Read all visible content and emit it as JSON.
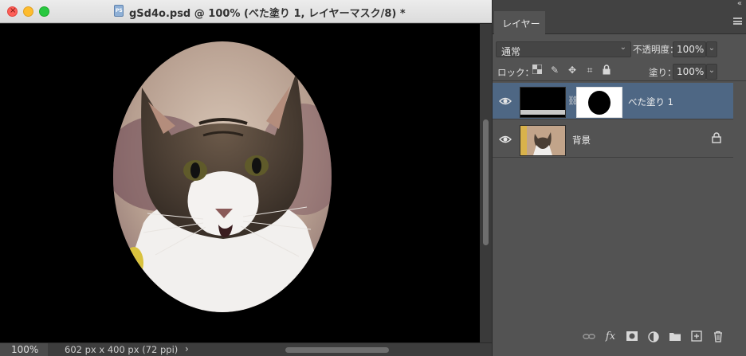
{
  "document": {
    "title": "gSd4o.psd @ 100% (べた塗り 1, レイヤーマスク/8) *",
    "file_icon_label": "PS",
    "zoom": "100%",
    "doc_info": "602 px x 400 px (72 ppi)",
    "status_arrow": "›"
  },
  "panel": {
    "tab_label": "レイヤー",
    "blend_mode": "通常",
    "opacity_label": "不透明度：",
    "opacity_value": "100%",
    "lock_label": "ロック：",
    "fill_label": "塗り：",
    "fill_value": "100%",
    "layers": [
      {
        "name": "べた塗り 1",
        "selected": true,
        "visible": true
      },
      {
        "name": "背景",
        "selected": false,
        "visible": true,
        "locked": true
      }
    ],
    "footer_icons": [
      "link-icon",
      "fx-icon",
      "mask-icon",
      "adjustment-icon",
      "folder-icon",
      "new-layer-icon",
      "trash-icon"
    ],
    "fx_label": "fx"
  },
  "colors": {
    "selected_row": "#4e6784",
    "panel_bg": "#535353",
    "canvas_bg": "#000000"
  }
}
